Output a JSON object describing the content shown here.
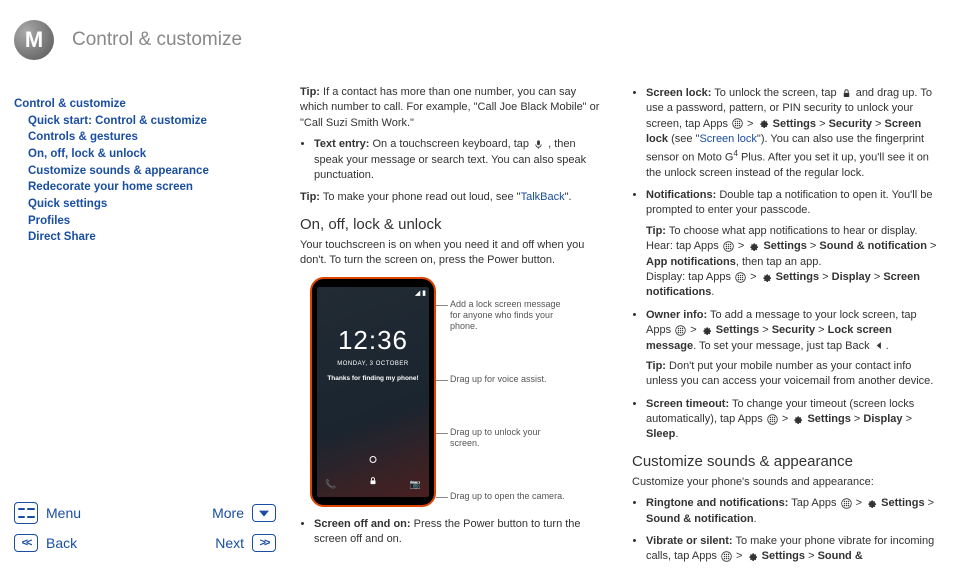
{
  "header": {
    "title": "Control & customize"
  },
  "toc": [
    {
      "label": "Control & customize",
      "indent": false
    },
    {
      "label": "Quick start: Control & customize",
      "indent": true
    },
    {
      "label": "Controls & gestures",
      "indent": true
    },
    {
      "label": "On, off, lock & unlock",
      "indent": true
    },
    {
      "label": "Customize sounds & appearance",
      "indent": true
    },
    {
      "label": "Redecorate your home screen",
      "indent": true
    },
    {
      "label": "Quick settings",
      "indent": true
    },
    {
      "label": "Profiles",
      "indent": true
    },
    {
      "label": "Direct Share",
      "indent": true
    }
  ],
  "nav": {
    "menu": "Menu",
    "more": "More",
    "back": "Back",
    "next": "Next"
  },
  "col1": {
    "tip1_label": "Tip:",
    "tip1_text": " If a contact has more than one number, you can say which number to call. For example, \"Call Joe Black Mobile\" or \"Call Suzi Smith Work.\"",
    "text_entry_label": "Text entry:",
    "text_entry_text_a": " On a touchscreen keyboard, tap ",
    "text_entry_text_b": " , then speak your message or search text. You can also speak punctuation.",
    "tip2_label": "Tip:",
    "tip2_text": " To make your phone read out loud, see \"",
    "tip2_link": "TalkBack",
    "tip2_end": "\".",
    "h_onoff": "On, off, lock & unlock",
    "onoff_intro": "Your touchscreen is on when you need it and off when you don't. To turn the screen on, press the Power button.",
    "screen_off_label": "Screen off and on:",
    "screen_off_text": " Press the Power button to turn the screen off and on."
  },
  "phone": {
    "time": "12:36",
    "date": "MONDAY, 3 OCTOBER",
    "msg": "Thanks for finding my phone!",
    "callout1": "Add a lock screen message for anyone who finds your phone.",
    "callout2": "Drag up for voice assist.",
    "callout3": "Drag up to unlock your screen.",
    "callout4": "Drag up to open the camera."
  },
  "col2": {
    "screen_lock_label": "Screen lock:",
    "screen_lock_a": " To unlock the screen, tap ",
    "screen_lock_b": " and drag up. To use a password, pattern, or PIN security to unlock your screen, tap Apps ",
    "gt": " > ",
    "settings": "Settings",
    "security": "Security",
    "screen_lock_bold": "Screen lock",
    "screen_lock_c": " (see \"",
    "screen_lock_link": "Screen lock",
    "screen_lock_d": "\"). You can also use the fingerprint sensor on Moto G",
    "sup4": "4",
    "screen_lock_e": " Plus. After you set it up, you'll see it on the unlock screen instead of the regular lock.",
    "notif_label": "Notifications:",
    "notif_text": " Double tap a notification to open it. You'll be prompted to enter your passcode.",
    "notif_tip_label": "Tip:",
    "notif_tip_a": " To choose what app notifications to hear or display. Hear: tap Apps ",
    "sound_notif": "Sound & notification",
    "app_notif": "App notifications",
    "notif_tip_b": ", then tap an app.",
    "notif_tip_c": "Display: tap Apps ",
    "display": "Display",
    "screen_notif": "Screen notifications",
    "owner_label": "Owner info:",
    "owner_a": " To add a message to your lock screen, tap Apps ",
    "lock_msg": "Lock screen message",
    "owner_b": ". To set your message, just tap Back ",
    "owner_tip_label": "Tip:",
    "owner_tip": " Don't put your mobile number as your contact info unless you can access your voicemail from another device.",
    "timeout_label": "Screen timeout:",
    "timeout_a": " To change your timeout (screen locks automatically), tap Apps ",
    "sleep": "Sleep",
    "h_customize": "Customize sounds & appearance",
    "customize_intro": "Customize your phone's sounds and appearance:",
    "ringtone_label": "Ringtone and notifications:",
    "ringtone_a": " Tap Apps ",
    "vibrate_label": "Vibrate or silent:",
    "vibrate_a": " To make your phone vibrate for incoming calls, tap Apps ",
    "sound_amp": "Sound &",
    "period": "."
  }
}
